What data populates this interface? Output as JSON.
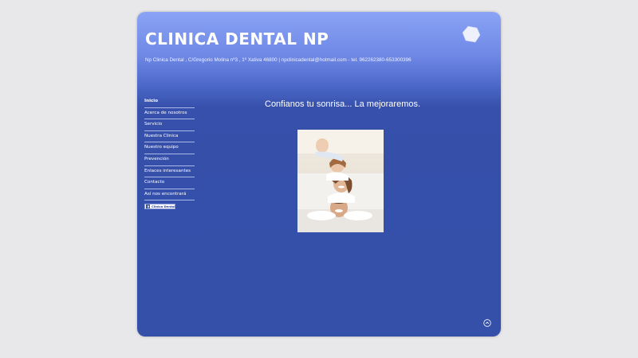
{
  "header": {
    "title": "CLINICA DENTAL NP",
    "subtitle": "Np Clinica Dental , C/Gregorio Molina nº3 , 1º Xativa 46800 | npclinicadental@hotmail.com - tel. 962262380-653300396"
  },
  "nav": {
    "items": [
      {
        "label": "Inicio"
      },
      {
        "label": "Acerca de nosotros"
      },
      {
        "label": "Servicio"
      },
      {
        "label": "Nuestra Clinica"
      },
      {
        "label": "Nuestro equipo"
      },
      {
        "label": "Prevención"
      },
      {
        "label": "Enlaces interesantes"
      },
      {
        "label": "Contacto"
      },
      {
        "label": "Así nos encontrará"
      }
    ],
    "active_index": 0
  },
  "badge": {
    "label": "Clinica Dental"
  },
  "main": {
    "tagline": "Confianos tu sonrisa... La mejoraremos."
  },
  "icons": {
    "logo": "hexagon-logo-icon",
    "scroll_top": "chevron-up-icon",
    "badge": "facebook-icon"
  },
  "colors": {
    "page_bg": "#e8e8ea",
    "card_bg": "#3450a8",
    "header_top": "#8aa3f5",
    "text": "#ffffff"
  }
}
